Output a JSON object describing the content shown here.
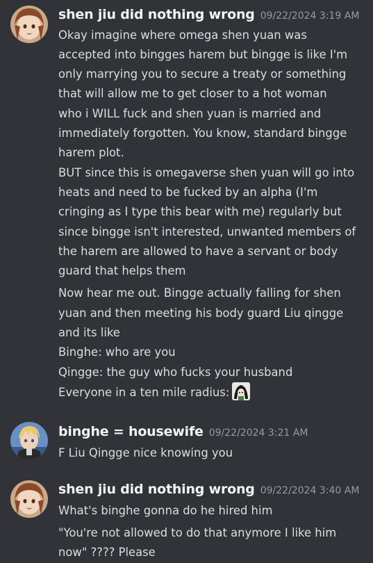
{
  "messages": [
    {
      "username": "shen jiu did nothing wrong",
      "timestamp": "09/22/2024 3:19 AM",
      "lines": [
        "Okay imagine where omega shen yuan was",
        "accepted into bingges harem but bingge is like I'm",
        "only marrying you to secure a treaty or something",
        "that will allow me to get closer to a hot woman",
        "who i WILL fuck and shen yuan is married and",
        "immediately forgotten. You know, standard bingge",
        "harem plot.",
        "BUT since this is omegaverse shen yuan will go into",
        "heats and need to be fucked by an alpha (I'm",
        "cringing as I type this bear with me) regularly but",
        "since bingge isn't interested, unwanted members of",
        "the harem are allowed to have a servant or body",
        "guard that helps them",
        "Now hear me out. Bingge actually falling for shen",
        "yuan and then meeting his body guard Liu qingge",
        "and its like",
        "Binghe: who are you",
        "Qingge: the guy who fucks your husband",
        "Everyone in a ten mile radius:"
      ]
    },
    {
      "username": "binghe = housewife",
      "timestamp": "09/22/2024 3:21 AM",
      "lines": [
        "F Liu Qingge nice knowing you"
      ]
    },
    {
      "username": "shen jiu did nothing wrong",
      "timestamp": "09/22/2024 3:40 AM",
      "lines": [
        "What's binghe gonna do he hired him",
        "\"You're not allowed to do that anymore I like him",
        "now\" ???? Please"
      ]
    }
  ],
  "icons": {
    "avatar1": "anime-girl-avatar",
    "avatar2": "anime-boy-avatar",
    "emoji": "custom-emoji-character"
  },
  "colors": {
    "background": "#313338",
    "username": "#f2f3f5",
    "timestamp": "#949ba4",
    "text": "#dbdee1"
  }
}
